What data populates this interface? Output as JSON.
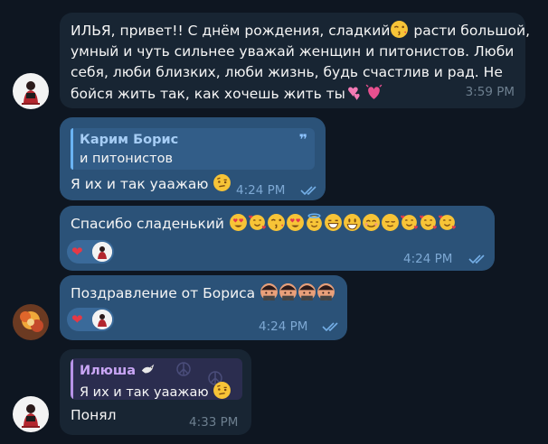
{
  "messages": [
    {
      "id": "m1",
      "direction": "incoming",
      "text_line1": "ИЛЬЯ, привет!! С днём рождения, сладкий",
      "text_line1b": " расти большой,",
      "text_line2": "умный и чуть сильнее уважай женщин и питонистов. Люби",
      "text_line3": "себя, люби близких, люби жизнь, будь счастлив и рад. Не",
      "text_line4": "бойся жить так, как хочешь жить ты",
      "time": "3:59 PM"
    },
    {
      "id": "m2",
      "direction": "outgoing",
      "reply_name": "Карим Борис",
      "reply_text": "и питонистов",
      "text": "Я их и так уаажаю",
      "time": "4:24 PM"
    },
    {
      "id": "m3",
      "direction": "outgoing",
      "text": "Спасибо сладенький",
      "reaction": "heart",
      "time": "4:24 PM"
    },
    {
      "id": "m4",
      "direction": "outgoing",
      "text": "Поздравление от Бориса",
      "reaction": "heart",
      "time": "4:24 PM"
    },
    {
      "id": "m5",
      "direction": "incoming",
      "reply_name": "Илюша",
      "reply_text": "Я их и так уаажаю",
      "text": "Понял",
      "time": "4:33 PM"
    }
  ],
  "colors": {
    "background": "#0e1621",
    "incoming_bubble": "#182533",
    "outgoing_bubble": "#2b5278",
    "heart": "#e53946"
  },
  "icons": {
    "read": "double-check-icon",
    "heart": "heart-icon",
    "quote": "quote-icon"
  },
  "glyphs": {
    "heart": "❤",
    "quote": "❞"
  }
}
